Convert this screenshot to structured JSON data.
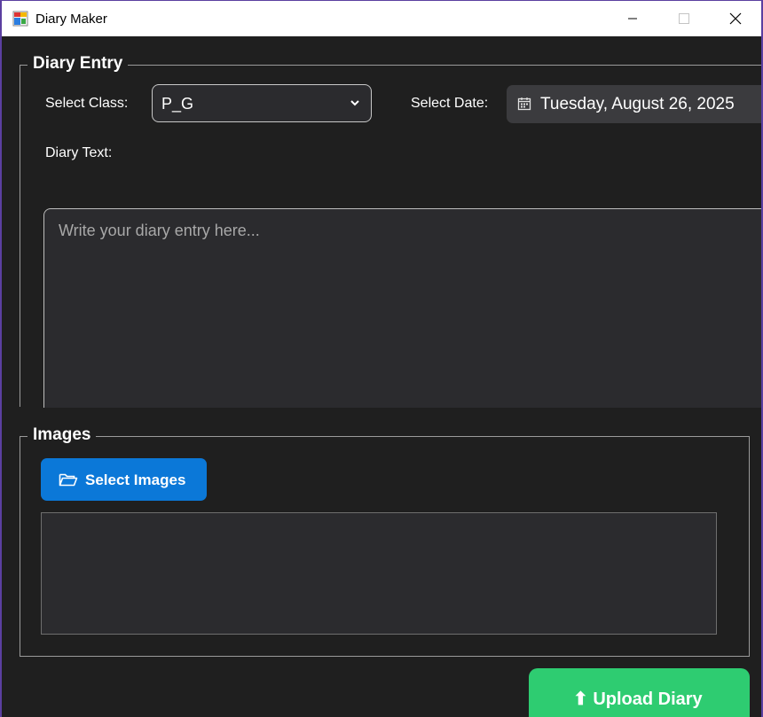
{
  "window": {
    "title": "Diary Maker",
    "controls": {
      "minimize": "minimize-icon",
      "maximize": "maximize-icon",
      "close": "close-icon"
    }
  },
  "diary_entry": {
    "legend": "Diary Entry",
    "class_label": "Select Class:",
    "class_value": "P_G",
    "date_label": "Select Date:",
    "date_value": "Tuesday, August 26, 2025",
    "text_label": "Diary Text:",
    "text_placeholder": "Write your diary entry here...",
    "text_value": ""
  },
  "images": {
    "legend": "Images",
    "select_button_label": "Select Images",
    "select_button_icon": "folder-icon"
  },
  "actions": {
    "upload_label": "⬆ Upload Diary"
  },
  "colors": {
    "background": "#1f1f1f",
    "panel": "#2b2b2e",
    "accent_blue": "#0b78d8",
    "accent_green": "#2ecc71",
    "window_border": "#5b3fa0"
  }
}
